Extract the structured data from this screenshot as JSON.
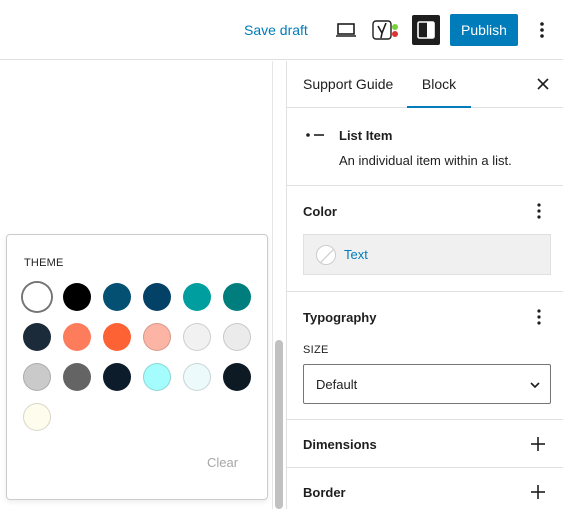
{
  "topbar": {
    "save_draft": "Save draft",
    "publish": "Publish",
    "icons": [
      "desktop-preview-icon",
      "yoast-seo-icon",
      "sidebar-toggle-icon",
      "more-vertical-icon"
    ]
  },
  "color_popover": {
    "title": "THEME",
    "clear": "Clear",
    "selected_index": 0,
    "swatches": [
      "#ffffff",
      "#000000",
      "#045073",
      "#034266",
      "#009e9e",
      "#007e7e",
      "#1c2b3a",
      "#fc7c5c",
      "#fc6234",
      "#fcb4a4",
      "#f1f1f1",
      "#ebebeb",
      "#cacaca",
      "#646464",
      "#0c1c2a",
      "#a4fcfc",
      "#ecfafc",
      "#0d1a24",
      "#fefcec"
    ]
  },
  "sidebar": {
    "tabs": [
      "Support Guide",
      "Block"
    ],
    "active_tab": "Block",
    "block": {
      "title": "List Item",
      "description": "An individual item within a list."
    },
    "color_panel": {
      "title": "Color",
      "items": [
        "Text"
      ]
    },
    "typography_panel": {
      "title": "Typography",
      "size_label": "SIZE",
      "size_value": "Default"
    },
    "dimensions_panel": {
      "title": "Dimensions"
    },
    "border_panel": {
      "title": "Border"
    }
  },
  "colors": {
    "accent": "#007cba",
    "text": "#1e1e1e",
    "border": "#e0e0e0"
  }
}
